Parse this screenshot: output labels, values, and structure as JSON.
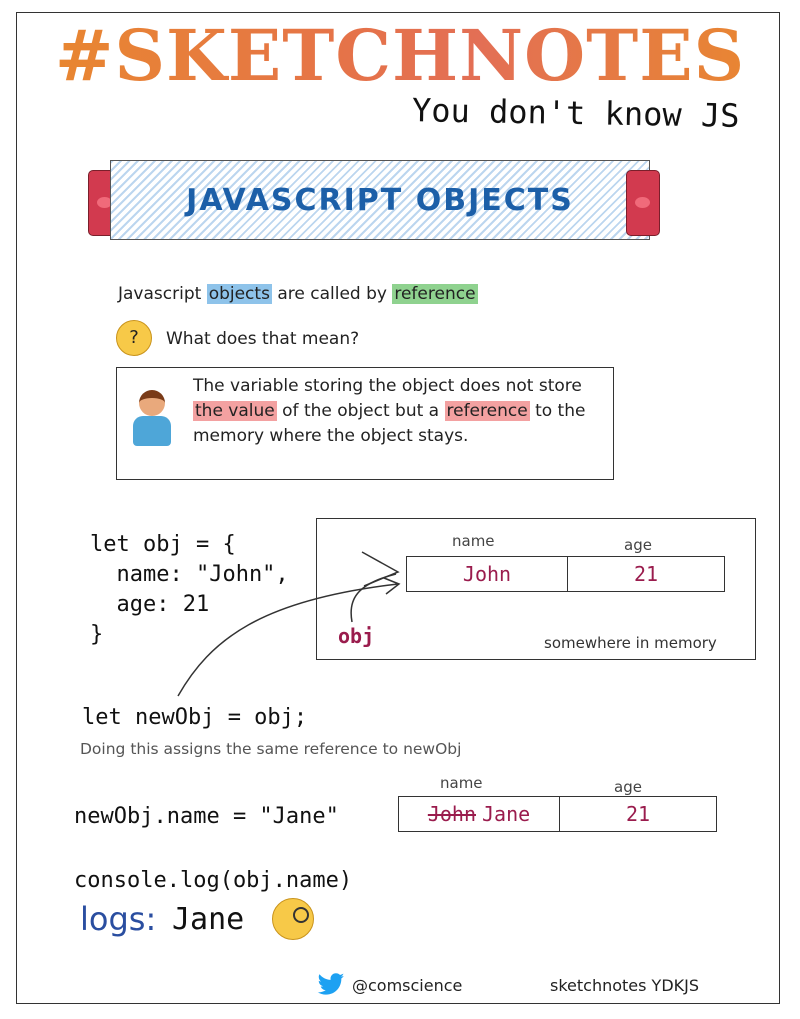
{
  "header": {
    "title": "#SKETCHNOTES",
    "subtitle": "You don't know JS"
  },
  "banner": {
    "text": "JAVASCRIPT OBJECTS"
  },
  "intro": {
    "part1": "Javascript ",
    "objects": "objects",
    "part2": " are called by ",
    "reference": "reference"
  },
  "question": "What does that mean?",
  "explanation": {
    "part1": "The variable storing the object does not store ",
    "the_value": "the value",
    "part2": " of the object but a ",
    "reference": "reference",
    "part3": " to the memory where the object stays."
  },
  "code_obj": "let obj = {\n  name: \"John\",\n  age: 21\n}",
  "memory": {
    "name_label": "name",
    "age_label": "age",
    "name_value": "John",
    "age_value": "21",
    "var_label": "obj",
    "caption": "somewhere in memory"
  },
  "code_newobj": "let newObj = obj;",
  "assign_note": "Doing this assigns the same reference to newObj",
  "code_setname": "newObj.name = \"Jane\"",
  "memory2": {
    "name_label": "name",
    "age_label": "age",
    "old_name": "John",
    "new_name": "Jane",
    "age_value": "21"
  },
  "code_log": "console.log(obj.name)",
  "logs": {
    "label": "logs:",
    "value": "Jane"
  },
  "footer": {
    "handle": "@comscience",
    "credit": "sketchnotes YDKJS"
  },
  "colors": {
    "title_orange": "#e98a2c",
    "banner_blue": "#1c5fa8",
    "value_maroon": "#9a1c4d",
    "highlight_blue": "#8ec3ea",
    "highlight_green": "#8fd28f",
    "highlight_red": "#f3a1a1"
  },
  "icons": [
    "thinking-face-icon",
    "person-tipping-hand-icon",
    "face-with-monocle-icon",
    "twitter-bird-icon",
    "ribbon-tab-icon"
  ]
}
